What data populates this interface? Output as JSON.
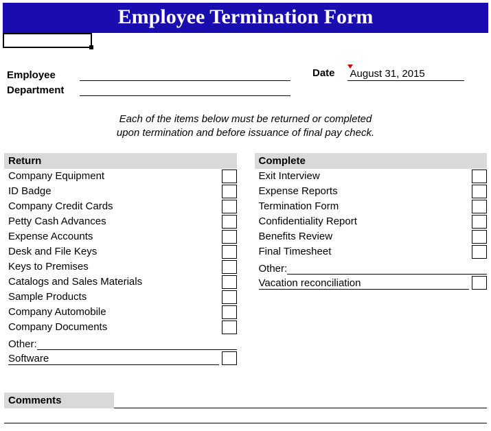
{
  "title": "Employee Termination Form",
  "fields": {
    "employee_label": "Employee",
    "department_label": "Department",
    "date_label": "Date",
    "date_value": "August 31, 2015"
  },
  "instructions_line1": "Each of the items below must be returned or completed",
  "instructions_line2": "upon termination and before issuance of final pay check.",
  "return": {
    "header": "Return",
    "items": [
      "Company Equipment",
      "ID Badge",
      "Company Credit Cards",
      "Petty Cash Advances",
      "Expense Accounts",
      "Desk and File Keys",
      "Keys to Premises",
      "Catalogs and Sales Materials",
      "Sample Products",
      "Company Automobile",
      "Company Documents"
    ],
    "other_label": "Other:",
    "write_in": "Software"
  },
  "complete": {
    "header": "Complete",
    "items": [
      "Exit Interview",
      "Expense Reports",
      "Termination Form",
      "Confidentiality Report",
      "Benefits Review",
      "Final Timesheet"
    ],
    "other_label": "Other:",
    "write_in": "Vacation reconciliation"
  },
  "comments_label": "Comments"
}
